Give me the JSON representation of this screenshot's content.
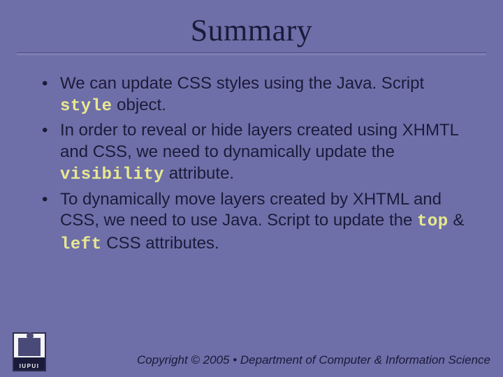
{
  "title": "Summary",
  "bullets": [
    {
      "pre": "We can update CSS styles using the Java. Script ",
      "code1": "style",
      "mid": " object.",
      "code2": "",
      "mid2": "",
      "code3": "",
      "tail": ""
    },
    {
      "pre": "In order to reveal or hide layers created using XHMTL and CSS, we need to dynamically update the ",
      "code1": "visibility",
      "mid": " attribute.",
      "code2": "",
      "mid2": "",
      "code3": "",
      "tail": ""
    },
    {
      "pre": "To dynamically move layers created by XHTML and CSS, we need to use Java. Script to update the ",
      "code1": "top",
      "mid": " & ",
      "code2": "left",
      "mid2": " CSS attributes.",
      "code3": "",
      "tail": ""
    }
  ],
  "logo_text": "IUPUI",
  "copyright": "Copyright © 2005 • Department of Computer & Information Science"
}
